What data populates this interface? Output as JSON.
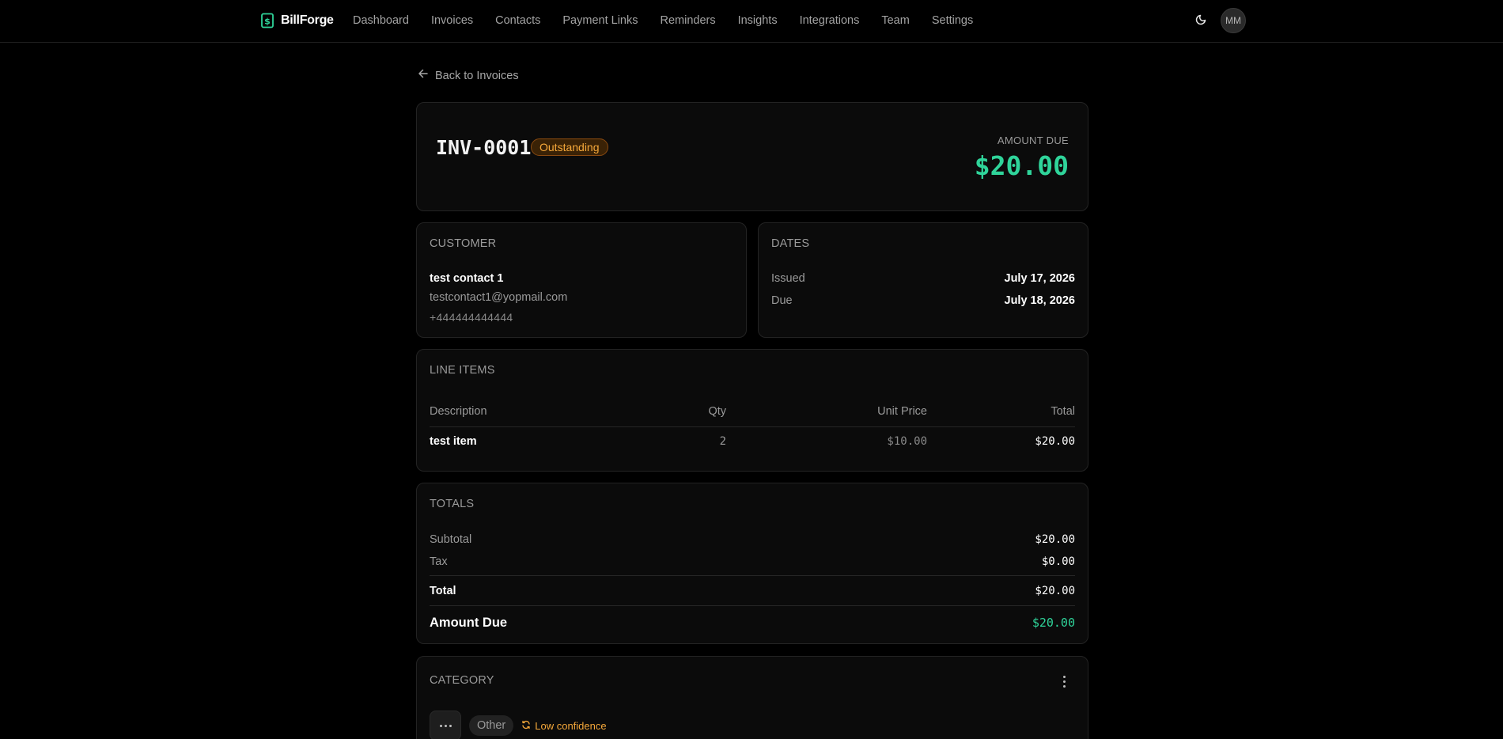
{
  "brand": {
    "name": "BillForge"
  },
  "nav": {
    "items": [
      "Dashboard",
      "Invoices",
      "Contacts",
      "Payment Links",
      "Reminders",
      "Insights",
      "Integrations",
      "Team",
      "Settings"
    ]
  },
  "user": {
    "initials": "MM"
  },
  "back_link": {
    "label": "Back to Invoices"
  },
  "invoice": {
    "number": "INV-0001",
    "status": "Outstanding",
    "amount_due_label": "AMOUNT DUE",
    "amount_due": "$20.00"
  },
  "customer": {
    "title": "CUSTOMER",
    "name": "test contact 1",
    "email": "testcontact1@yopmail.com",
    "phone": "+444444444444"
  },
  "dates": {
    "title": "DATES",
    "issued_label": "Issued",
    "issued": "July 17, 2026",
    "due_label": "Due",
    "due": "July 18, 2026"
  },
  "line_items": {
    "title": "LINE ITEMS",
    "columns": [
      "Description",
      "Qty",
      "Unit Price",
      "Total"
    ],
    "rows": [
      {
        "description": "test item",
        "qty": "2",
        "unit_price": "$10.00",
        "total": "$20.00"
      }
    ]
  },
  "totals": {
    "title": "TOTALS",
    "subtotal_label": "Subtotal",
    "subtotal": "$20.00",
    "tax_label": "Tax",
    "tax": "$0.00",
    "total_label": "Total",
    "total": "$20.00",
    "amount_due_label": "Amount Due",
    "amount_due": "$20.00"
  },
  "category": {
    "title": "CATEGORY",
    "value": "Other",
    "confidence": "Low confidence"
  },
  "colors": {
    "accent_green": "#2fd49a",
    "warning_orange": "#f5a83a",
    "background": "#000000",
    "card": "#0b0b0b"
  }
}
